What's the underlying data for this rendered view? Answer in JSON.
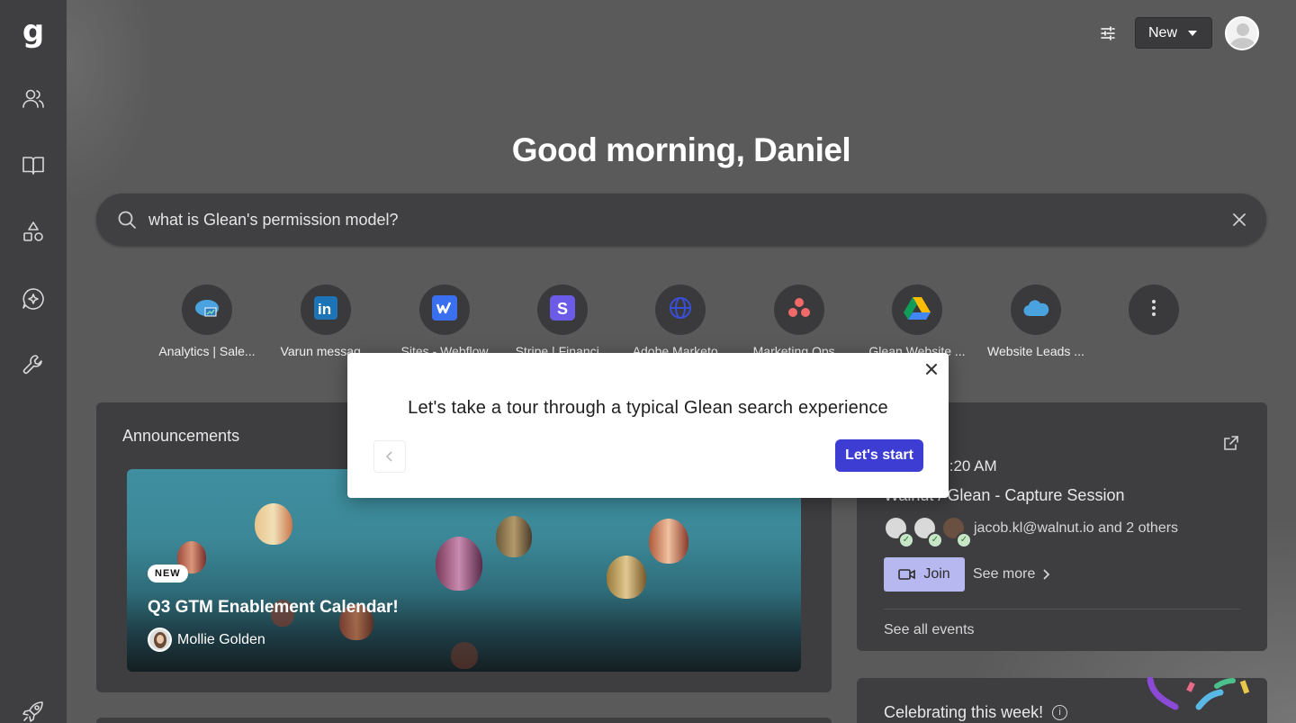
{
  "greeting": "Good morning, Daniel",
  "header": {
    "new_label": "New"
  },
  "search": {
    "value": "what is Glean's permission model?",
    "placeholder": ""
  },
  "shortcuts": [
    {
      "label": "Analytics | Sale...",
      "icon": "salesforce-analytics-icon"
    },
    {
      "label": "Varun messag...",
      "icon": "linkedin-icon"
    },
    {
      "label": "Sites - Webflow",
      "icon": "webflow-icon"
    },
    {
      "label": "Stripe | Financi...",
      "icon": "stripe-icon"
    },
    {
      "label": "Adobe Marketo...",
      "icon": "globe-icon"
    },
    {
      "label": "Marketing Ops...",
      "icon": "asana-icon"
    },
    {
      "label": "Glean Website ...",
      "icon": "google-drive-icon"
    },
    {
      "label": "Website Leads ...",
      "icon": "salesforce-icon"
    },
    {
      "label": "",
      "icon": "more-icon"
    }
  ],
  "announcements": {
    "title": "Announcements",
    "badge": "NEW",
    "headline": "Q3 GTM Enablement Calendar!",
    "author": "Mollie Golden"
  },
  "calendar": {
    "time": "0 AM - 10:20 AM",
    "event": "Walnut / Glean - Capture Session",
    "attendees_text": "jacob.kl@walnut.io and 2 others",
    "join_label": "Join",
    "see_more_label": "See more",
    "see_all_label": "See all events"
  },
  "celebrating": {
    "title": "Celebrating this week!"
  },
  "tour_modal": {
    "message": "Let's take a tour through a typical Glean search experience",
    "start_label": "Let's start"
  },
  "colors": {
    "primary_button": "#3d3dd4",
    "join_button": "#b8b8f0",
    "sidebar": "#3f3f41",
    "panel": "#3e3e40"
  }
}
